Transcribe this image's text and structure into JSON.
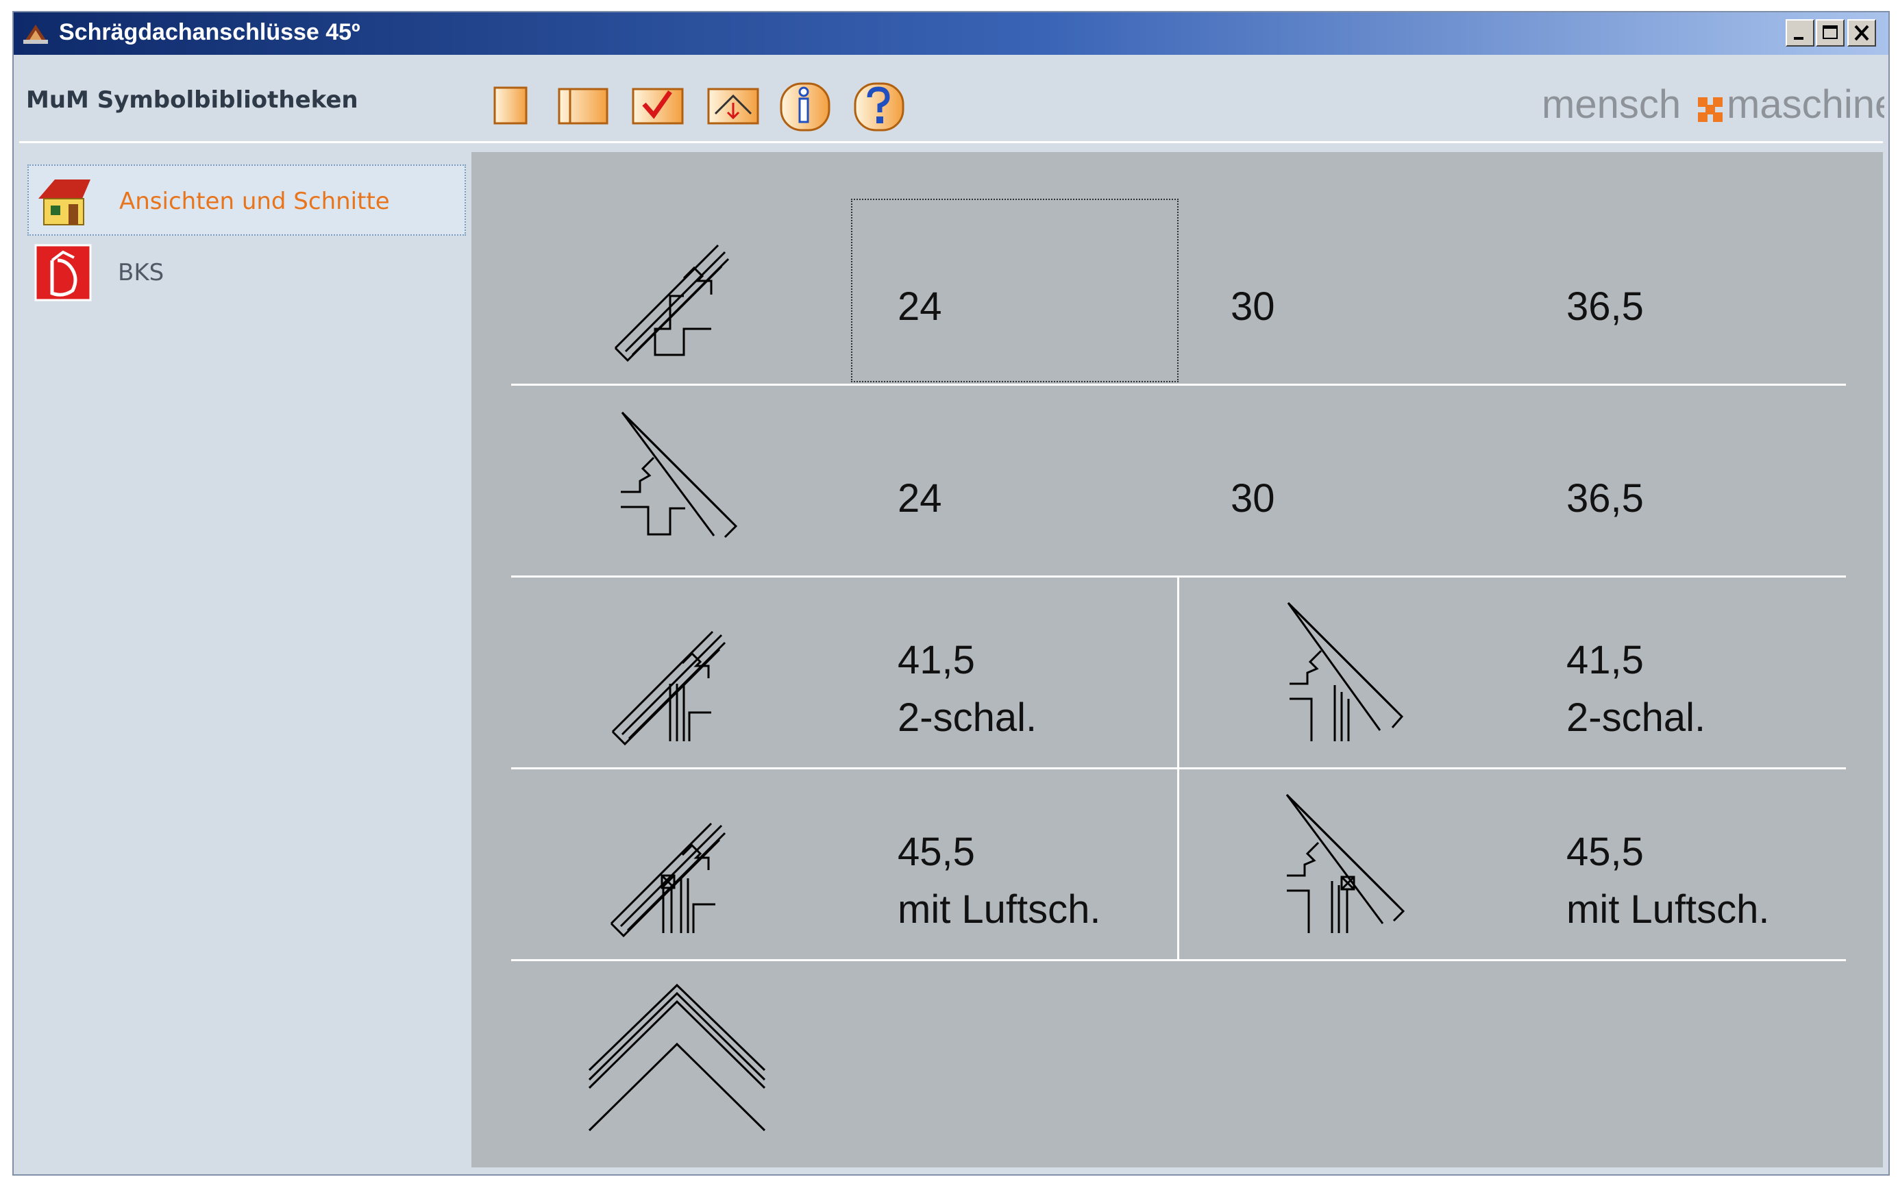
{
  "window": {
    "title": "Schrägdachanschlüsse 45º",
    "controls": {
      "minimize": "minimize-icon",
      "maximize": "maximize-icon",
      "close": "close-icon"
    }
  },
  "toolbar": {
    "label": "MuM Symbolbibliotheken",
    "buttons": [
      "page-icon",
      "book-icon",
      "checkmark-icon",
      "roof-insert-icon",
      "info-icon",
      "help-icon"
    ],
    "brand": {
      "left": "mensch",
      "right": "maschine",
      "accent_color": "#f07820"
    }
  },
  "sidebar": {
    "items": [
      {
        "label": "Ansichten und Schnitte",
        "icon": "house-icon",
        "selected": true,
        "color": "#e8741c"
      },
      {
        "label": "BKS",
        "icon": "fire-extinguisher-icon",
        "selected": false,
        "color": "#505a66"
      }
    ]
  },
  "grid": {
    "rows": [
      {
        "symbol": "roof-joint-left-symbol",
        "cells": [
          "24",
          "30",
          "36,5"
        ]
      },
      {
        "symbol": "roof-joint-right-symbol",
        "cells": [
          "24",
          "30",
          "36,5"
        ]
      },
      {
        "symbol": "roof-joint-2-schal-symbol",
        "left": {
          "line1": "41,5",
          "line2": "2-schal."
        },
        "right": {
          "line1": "41,5",
          "line2": "2-schal."
        }
      },
      {
        "symbol": "roof-joint-air-gap-symbol",
        "left": {
          "line1": "45,5",
          "line2": "mit Luftsch."
        },
        "right": {
          "line1": "45,5",
          "line2": "mit Luftsch."
        }
      },
      {
        "symbol": "roof-ridge-symbol"
      }
    ]
  },
  "colors": {
    "panel_bg": "#b3b8bd",
    "window_bg": "#d4dde6",
    "title_gradient_start": "#0e2a6a"
  }
}
